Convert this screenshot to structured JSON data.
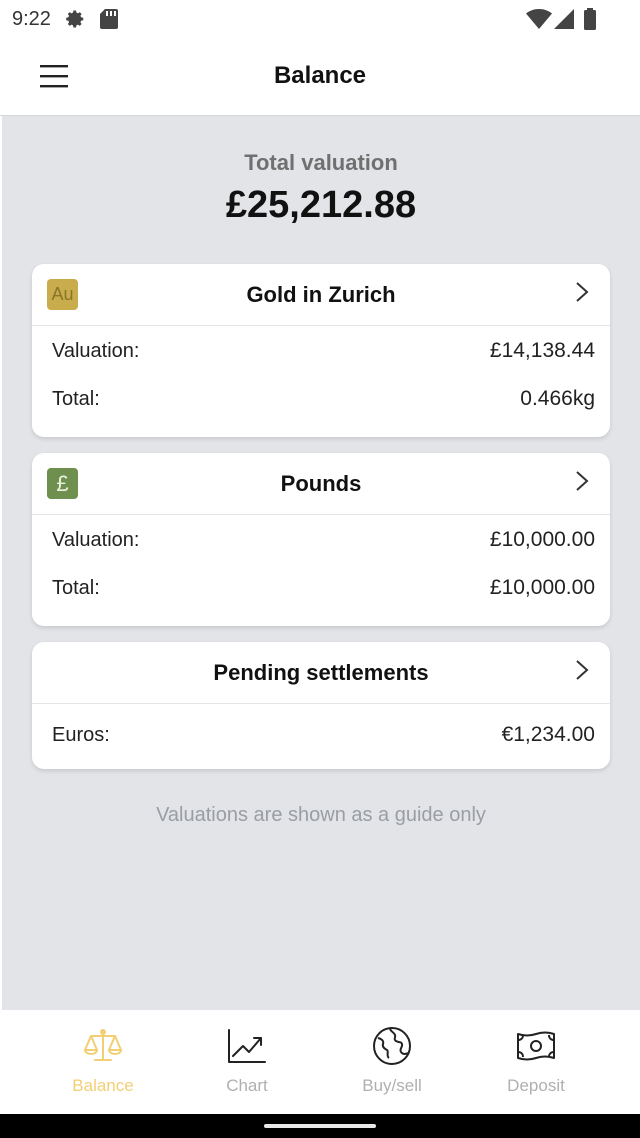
{
  "status_bar": {
    "time": "9:22",
    "icons": [
      "gear-icon",
      "sd-card-icon",
      "wifi-icon",
      "signal-icon",
      "battery-icon"
    ]
  },
  "app_bar": {
    "title": "Balance",
    "menu_icon": "hamburger-menu-icon"
  },
  "summary": {
    "label": "Total valuation",
    "value": "£25,212.88"
  },
  "cards": [
    {
      "title": "Gold in Zurich",
      "badge": "Au",
      "rows": [
        {
          "label": "Valuation:",
          "value": "£14,138.44"
        },
        {
          "label": "Total:",
          "value": "0.466kg"
        }
      ]
    },
    {
      "title": "Pounds",
      "badge": "£",
      "rows": [
        {
          "label": "Valuation:",
          "value": "£10,000.00"
        },
        {
          "label": "Total:",
          "value": "£10,000.00"
        }
      ]
    },
    {
      "title": "Pending settlements",
      "rows": [
        {
          "label": "Euros:",
          "value": "€1,234.00"
        }
      ]
    }
  ],
  "footnote": "Valuations are shown as a guide only",
  "bottom_nav": [
    {
      "label": "Balance",
      "icon": "scales-icon",
      "active": true
    },
    {
      "label": "Chart",
      "icon": "chart-icon",
      "active": false
    },
    {
      "label": "Buy/sell",
      "icon": "globe-icon",
      "active": false
    },
    {
      "label": "Deposit",
      "icon": "banknote-icon",
      "active": false
    }
  ],
  "colors": {
    "accent": "#f3cf74",
    "background": "#e2e4e8",
    "gold_badge": "#c9ad4c",
    "pound_badge": "#6f8f4e",
    "inactive_nav": "#b0b0b0"
  }
}
